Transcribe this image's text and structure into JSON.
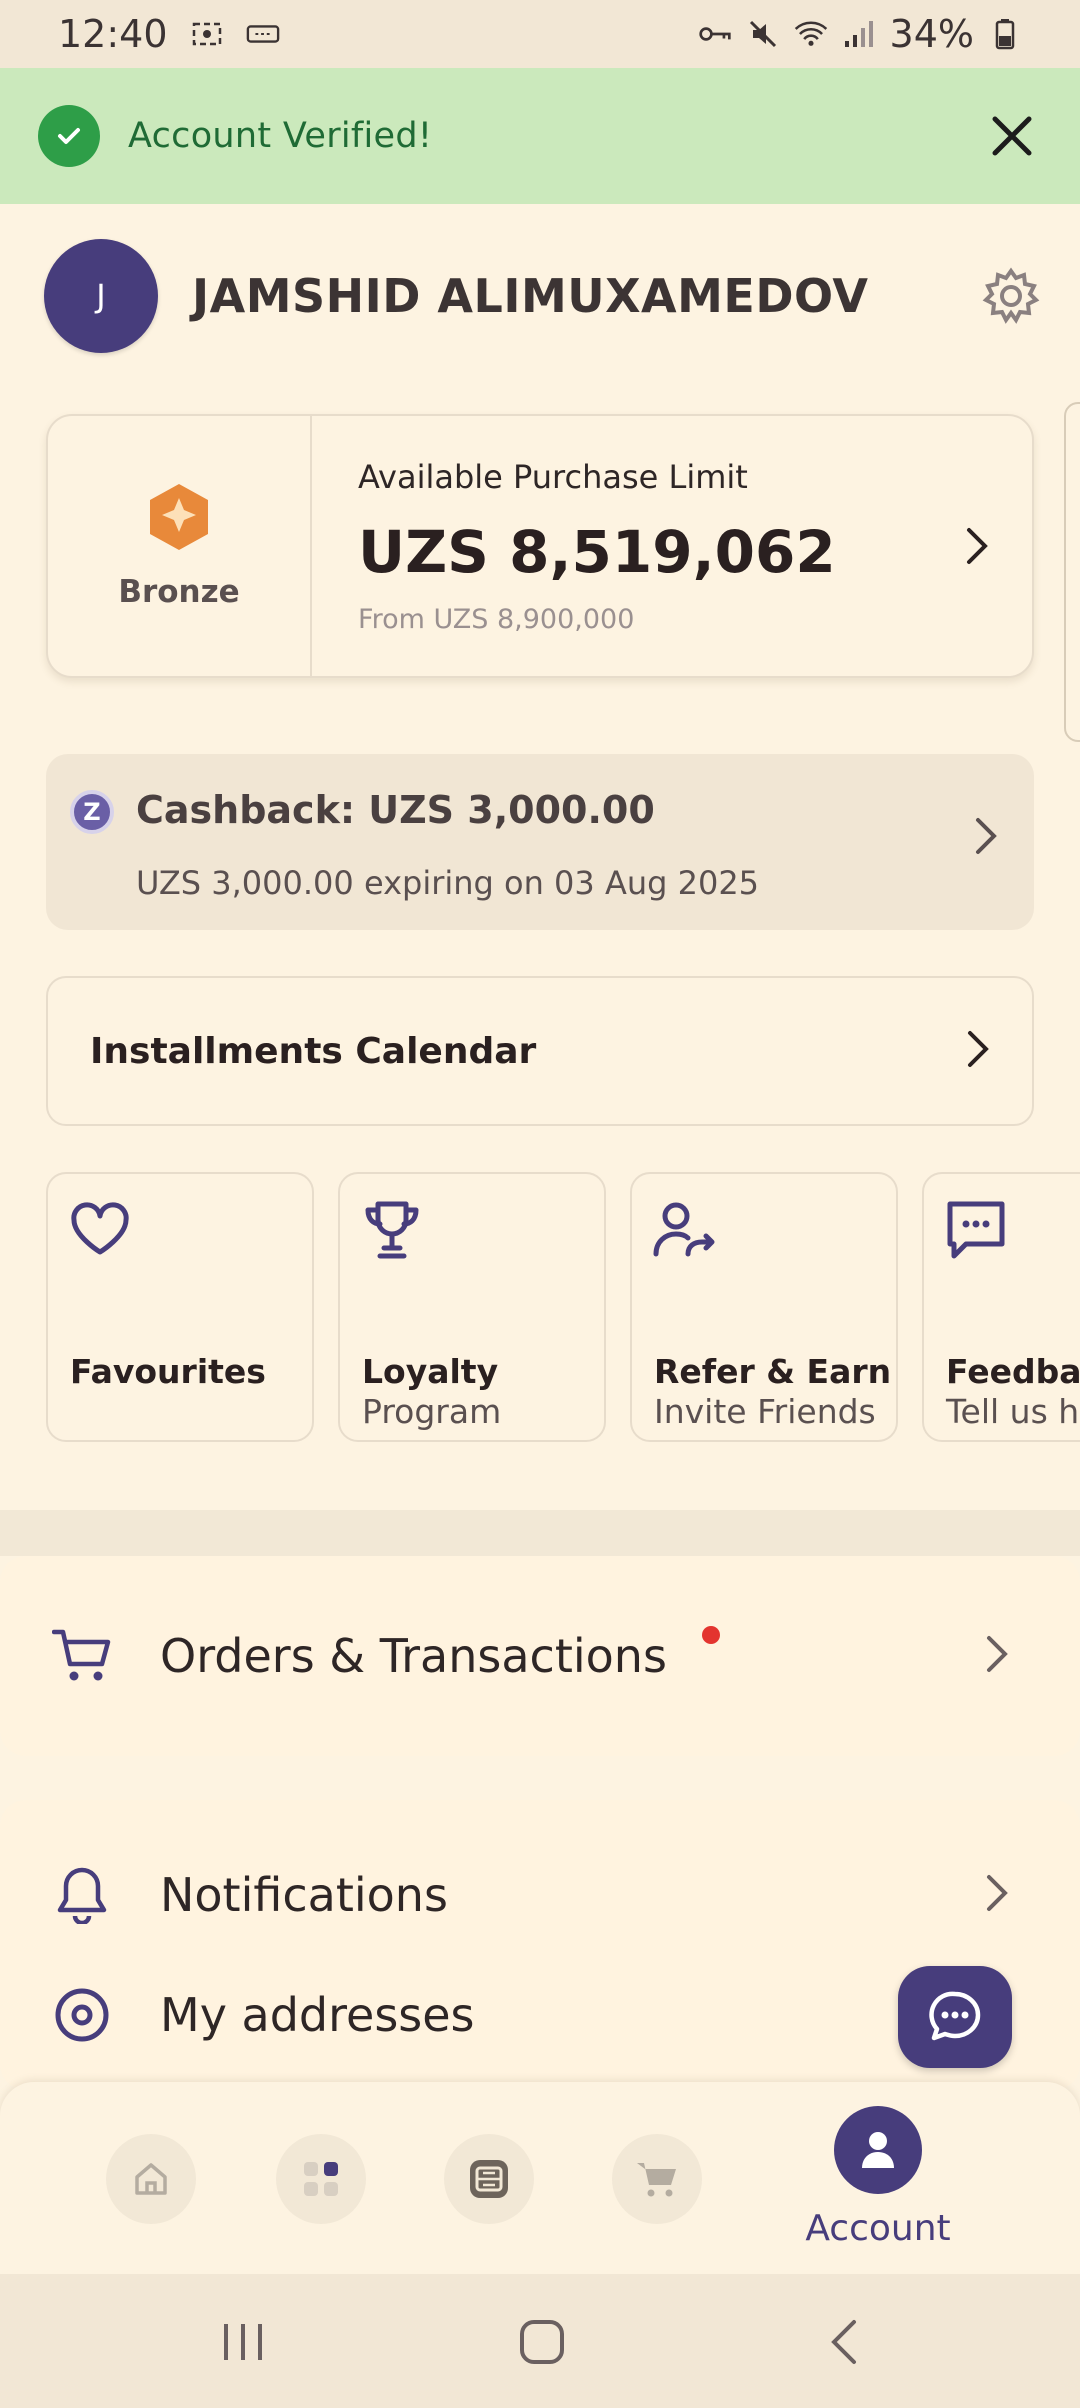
{
  "status_bar": {
    "time": "12:40",
    "battery": "34%"
  },
  "banner": {
    "text": "Account Verified!"
  },
  "profile": {
    "initial": "J",
    "name": "JAMSHID ALIMUXAMEDOV"
  },
  "limit_card": {
    "tier": "Bronze",
    "title": "Available Purchase Limit",
    "value": "UZS 8,519,062",
    "subtitle": "From UZS 8,900,000"
  },
  "cashback": {
    "badge": "Z",
    "title": "Cashback: UZS 3,000.00",
    "subtitle": "UZS 3,000.00 expiring on 03 Aug 2025"
  },
  "calendar": {
    "label": "Installments Calendar"
  },
  "tiles": [
    {
      "title": "Favourites",
      "subtitle": "",
      "icon": "heart-icon"
    },
    {
      "title": "Loyalty",
      "subtitle": "Program",
      "icon": "trophy-icon"
    },
    {
      "title": "Refer & Earn",
      "subtitle": "Invite Friends",
      "icon": "refer-user-icon"
    },
    {
      "title": "Feedbac",
      "subtitle": "Tell us ho",
      "icon": "chat-dots-icon"
    }
  ],
  "menu": {
    "orders": "Orders & Transactions",
    "notifications": "Notifications",
    "addresses": "My addresses"
  },
  "bottom_nav": {
    "items": [
      "home-icon",
      "categories-icon",
      "payments-icon",
      "cart-icon"
    ],
    "active_label": "Account"
  },
  "colors": {
    "brand": "#473d7c",
    "success": "#2e9e48",
    "background": "#fdf3e1",
    "tier": "#e8893a"
  }
}
